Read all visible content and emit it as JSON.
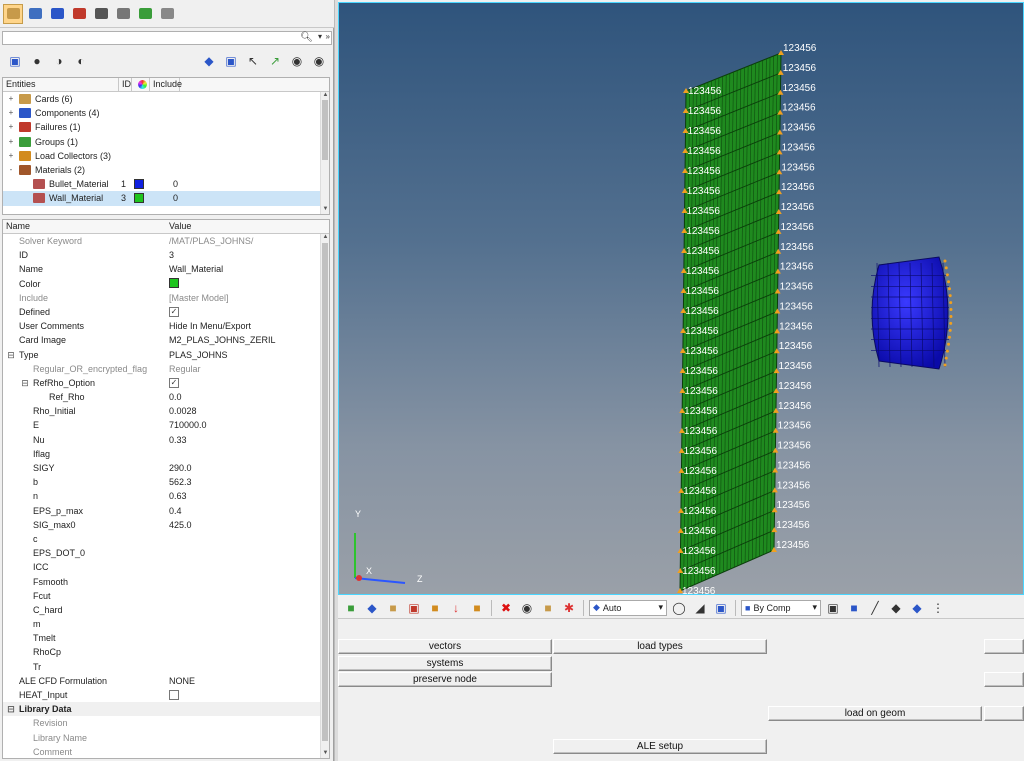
{
  "entities_header": {
    "name": "Entities",
    "id": "ID",
    "include": "Include"
  },
  "tree": [
    {
      "label": "Cards (6)",
      "icon_color": "#c79a4a",
      "depth": 0,
      "expander": "+"
    },
    {
      "label": "Components (4)",
      "icon_color": "#2b56c8",
      "depth": 0,
      "expander": "+"
    },
    {
      "label": "Failures (1)",
      "icon_color": "#c0392b",
      "depth": 0,
      "expander": "+"
    },
    {
      "label": "Groups (1)",
      "icon_color": "#3a9d3a",
      "depth": 0,
      "expander": "+"
    },
    {
      "label": "Load Collectors (3)",
      "icon_color": "#d28b1e",
      "depth": 0,
      "expander": "+"
    },
    {
      "label": "Materials (2)",
      "icon_color": "#a0562a",
      "depth": 0,
      "expander": "-"
    },
    {
      "label": "Bullet_Material",
      "id": "1",
      "color": "#1020e0",
      "include": "0",
      "icon_color": "#b45050",
      "depth": 1
    },
    {
      "label": "Wall_Material",
      "id": "3",
      "color": "#1ec41e",
      "include": "0",
      "icon_color": "#b45050",
      "depth": 1,
      "selected": true
    }
  ],
  "props_header": {
    "name": "Name",
    "value": "Value"
  },
  "props": [
    {
      "name": "Solver Keyword",
      "value": "/MAT/PLAS_JOHNS/",
      "grey": true,
      "indent": 0
    },
    {
      "name": "ID",
      "value": "3",
      "indent": 0
    },
    {
      "name": "Name",
      "value": "Wall_Material",
      "indent": 0
    },
    {
      "name": "Color",
      "value": "",
      "color": "#1ec41e",
      "indent": 0
    },
    {
      "name": "Include",
      "value": "[Master Model]",
      "grey": true,
      "indent": 0
    },
    {
      "name": "Defined",
      "value": "",
      "checkbox": "checked",
      "indent": 0
    },
    {
      "name": "User Comments",
      "value": "Hide In Menu/Export",
      "indent": 0
    },
    {
      "name": "Card Image",
      "value": "M2_PLAS_JOHNS_ZERIL",
      "indent": 0
    },
    {
      "name": "Type",
      "value": "PLAS_JOHNS",
      "indent": 0,
      "expander": "-"
    },
    {
      "name": "Regular_OR_encrypted_flag",
      "value": "Regular",
      "grey": true,
      "indent": 1
    },
    {
      "name": "RefRho_Option",
      "value": "",
      "checkbox": "checked",
      "indent": 1,
      "expander": "-"
    },
    {
      "name": "Ref_Rho",
      "value": "0.0",
      "indent": 2
    },
    {
      "name": "Rho_Initial",
      "value": "0.0028",
      "indent": 1
    },
    {
      "name": "E",
      "value": "710000.0",
      "indent": 1
    },
    {
      "name": "Nu",
      "value": "0.33",
      "indent": 1
    },
    {
      "name": "Iflag",
      "value": "",
      "indent": 1
    },
    {
      "name": "SIGY",
      "value": "290.0",
      "indent": 1
    },
    {
      "name": "b",
      "value": "562.3",
      "indent": 1
    },
    {
      "name": "n",
      "value": "0.63",
      "indent": 1
    },
    {
      "name": "EPS_p_max",
      "value": "0.4",
      "indent": 1
    },
    {
      "name": "SIG_max0",
      "value": "425.0",
      "indent": 1
    },
    {
      "name": "c",
      "value": "",
      "indent": 1
    },
    {
      "name": "EPS_DOT_0",
      "value": "",
      "indent": 1
    },
    {
      "name": "ICC",
      "value": "",
      "indent": 1
    },
    {
      "name": "Fsmooth",
      "value": "",
      "indent": 1
    },
    {
      "name": "Fcut",
      "value": "",
      "indent": 1
    },
    {
      "name": "C_hard",
      "value": "",
      "indent": 1
    },
    {
      "name": "m",
      "value": "",
      "indent": 1
    },
    {
      "name": "Tmelt",
      "value": "",
      "indent": 1
    },
    {
      "name": "RhoCp",
      "value": "",
      "indent": 1
    },
    {
      "name": "Tr",
      "value": "",
      "indent": 1
    },
    {
      "name": "ALE CFD Formulation",
      "value": "NONE",
      "indent": 0
    },
    {
      "name": "HEAT_Input",
      "value": "",
      "checkbox": "unchecked",
      "indent": 0
    },
    {
      "name": "Library Data",
      "value": "",
      "group": true,
      "indent": 0,
      "expander": "-"
    },
    {
      "name": "Revision",
      "value": "",
      "grey": true,
      "indent": 1
    },
    {
      "name": "Library Name",
      "value": "",
      "grey": true,
      "indent": 1
    },
    {
      "name": "Comment",
      "value": "",
      "grey": true,
      "indent": 1
    }
  ],
  "viewport": {
    "label_text": "123456",
    "axis_y": "Y",
    "axis_x": "X",
    "axis_z": "Z",
    "wall_color": "#1f8a1f",
    "bullet_color": "#1a1ae6"
  },
  "vp_toolbar": {
    "auto_label": "Auto",
    "bycomp_label": "By Comp"
  },
  "panel_buttons": {
    "vectors": "vectors",
    "systems": "systems",
    "preserve_node": "preserve node",
    "load_types": "load types",
    "load_on_geom": "load on geom",
    "ale_setup": "ALE setup"
  }
}
